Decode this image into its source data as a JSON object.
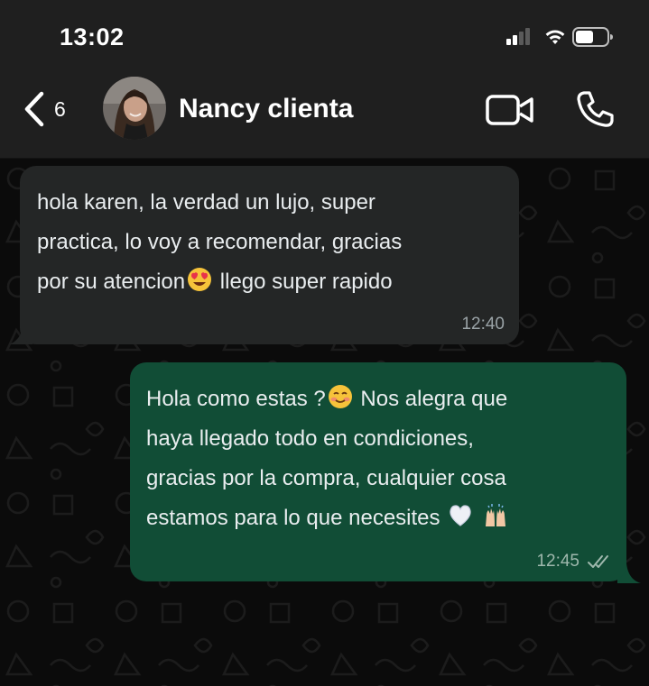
{
  "status_bar": {
    "time": "13:02",
    "icons": [
      "signal-icon",
      "wifi-icon",
      "battery-icon"
    ]
  },
  "header": {
    "back_icon": "chevron-left-icon",
    "unread_count": "6",
    "contact_name": "Nancy clienta",
    "actions": [
      "video-call-icon",
      "phone-icon"
    ]
  },
  "messages": [
    {
      "direction": "incoming",
      "lines": [
        {
          "text": "hola karen, la verdad un lujo, super"
        },
        {
          "text": "practica, lo voy a recomendar, gracias"
        },
        {
          "before": "por su atencion",
          "emoji": "heart-eyes-emoji",
          "after": " llego super rapido"
        }
      ],
      "time": "12:40"
    },
    {
      "direction": "outgoing",
      "lines": [
        {
          "before": "Hola como estas ?",
          "emoji": "smiling-face-emoji",
          "after": " Nos alegra que"
        },
        {
          "text": "haya llegado todo en condiciones,"
        },
        {
          "text": "gracias por la compra, cualquier cosa"
        },
        {
          "before": "estamos para lo que necesites ",
          "emoji": "white-heart-emoji",
          "after": " ",
          "emoji2": "raising-hands-emoji"
        }
      ],
      "time": "12:45",
      "status_icon": "read-ticks-icon"
    }
  ],
  "colors": {
    "header_background": "#1f1f1f",
    "chat_background": "#0b0b0b",
    "incoming_bubble": "#242626",
    "outgoing_bubble": "#114d36",
    "text": "#e9edef",
    "meta_text": "#9aa3a7"
  }
}
